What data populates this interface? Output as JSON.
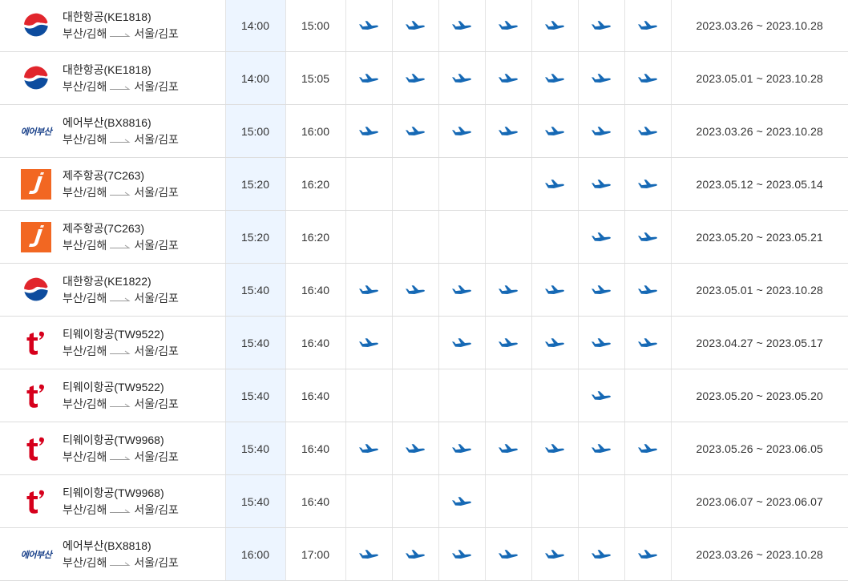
{
  "flights": [
    {
      "airline": "대한항공(KE1818)",
      "logo": "korean-air",
      "origin": "부산/김해",
      "destination": "서울/김포",
      "dep": "14:00",
      "arr": "15:00",
      "days": [
        1,
        1,
        1,
        1,
        1,
        1,
        1
      ],
      "period": "2023.03.26 ~ 2023.10.28"
    },
    {
      "airline": "대한항공(KE1818)",
      "logo": "korean-air",
      "origin": "부산/김해",
      "destination": "서울/김포",
      "dep": "14:00",
      "arr": "15:05",
      "days": [
        1,
        1,
        1,
        1,
        1,
        1,
        1
      ],
      "period": "2023.05.01 ~ 2023.10.28"
    },
    {
      "airline": "에어부산(BX8816)",
      "logo": "air-busan",
      "origin": "부산/김해",
      "destination": "서울/김포",
      "dep": "15:00",
      "arr": "16:00",
      "days": [
        1,
        1,
        1,
        1,
        1,
        1,
        1
      ],
      "period": "2023.03.26 ~ 2023.10.28"
    },
    {
      "airline": "제주항공(7C263)",
      "logo": "jeju-air",
      "origin": "부산/김해",
      "destination": "서울/김포",
      "dep": "15:20",
      "arr": "16:20",
      "days": [
        0,
        0,
        0,
        0,
        1,
        1,
        1
      ],
      "period": "2023.05.12 ~ 2023.05.14"
    },
    {
      "airline": "제주항공(7C263)",
      "logo": "jeju-air",
      "origin": "부산/김해",
      "destination": "서울/김포",
      "dep": "15:20",
      "arr": "16:20",
      "days": [
        0,
        0,
        0,
        0,
        0,
        1,
        1
      ],
      "period": "2023.05.20 ~ 2023.05.21"
    },
    {
      "airline": "대한항공(KE1822)",
      "logo": "korean-air",
      "origin": "부산/김해",
      "destination": "서울/김포",
      "dep": "15:40",
      "arr": "16:40",
      "days": [
        1,
        1,
        1,
        1,
        1,
        1,
        1
      ],
      "period": "2023.05.01 ~ 2023.10.28"
    },
    {
      "airline": "티웨이항공(TW9522)",
      "logo": "tway",
      "origin": "부산/김해",
      "destination": "서울/김포",
      "dep": "15:40",
      "arr": "16:40",
      "days": [
        1,
        0,
        1,
        1,
        1,
        1,
        1
      ],
      "period": "2023.04.27 ~ 2023.05.17"
    },
    {
      "airline": "티웨이항공(TW9522)",
      "logo": "tway",
      "origin": "부산/김해",
      "destination": "서울/김포",
      "dep": "15:40",
      "arr": "16:40",
      "days": [
        0,
        0,
        0,
        0,
        0,
        1,
        0
      ],
      "period": "2023.05.20 ~ 2023.05.20"
    },
    {
      "airline": "티웨이항공(TW9968)",
      "logo": "tway",
      "origin": "부산/김해",
      "destination": "서울/김포",
      "dep": "15:40",
      "arr": "16:40",
      "days": [
        1,
        1,
        1,
        1,
        1,
        1,
        1
      ],
      "period": "2023.05.26 ~ 2023.06.05"
    },
    {
      "airline": "티웨이항공(TW9968)",
      "logo": "tway",
      "origin": "부산/김해",
      "destination": "서울/김포",
      "dep": "15:40",
      "arr": "16:40",
      "days": [
        0,
        0,
        1,
        0,
        0,
        0,
        0
      ],
      "period": "2023.06.07 ~ 2023.06.07"
    },
    {
      "airline": "에어부산(BX8818)",
      "logo": "air-busan",
      "origin": "부산/김해",
      "destination": "서울/김포",
      "dep": "16:00",
      "arr": "17:00",
      "days": [
        1,
        1,
        1,
        1,
        1,
        1,
        1
      ],
      "period": "2023.03.26 ~ 2023.10.28"
    }
  ],
  "logo_text": {
    "air-busan": "에어부산"
  },
  "colors": {
    "plane": "#1669b5",
    "dep_column_bg": "#edf5ff",
    "korean_air_red": "#e1262d",
    "korean_air_blue": "#0d4c9e",
    "jeju_orange": "#f26722",
    "tway_red": "#d6001c"
  }
}
